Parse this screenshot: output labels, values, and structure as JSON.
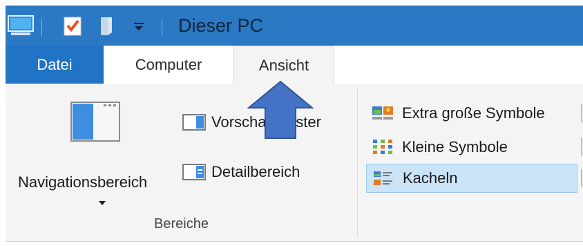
{
  "window": {
    "title": "Dieser PC"
  },
  "quick_access": {
    "icons": [
      "computer-icon",
      "properties-checkmark-icon",
      "new-folder-icon",
      "customize-dropdown-icon"
    ]
  },
  "tabs": [
    {
      "label": "Datei",
      "style": "file-tab",
      "color": "#2073c5"
    },
    {
      "label": "Computer"
    },
    {
      "label": "Ansicht",
      "active": true
    }
  ],
  "ribbon": {
    "panes_group": {
      "label": "Bereiche",
      "navigation_pane": {
        "label": "Navigationsbereich",
        "icon": "navigation-pane-icon"
      },
      "preview_pane": {
        "label": "Vorschaufenster",
        "icon": "preview-pane-icon"
      },
      "details_pane": {
        "label": "Detailbereich",
        "icon": "details-pane-icon"
      }
    },
    "layout_group": {
      "items": [
        {
          "label": "Extra große Symbole",
          "icon": "extra-large-icons-icon"
        },
        {
          "label": "Kleine Symbole",
          "icon": "small-icons-icon"
        },
        {
          "label": "Kacheln",
          "icon": "tiles-icon",
          "selected": true
        }
      ]
    }
  },
  "annotation": {
    "arrow_color": "#4472c4",
    "arrow_direction": "up"
  }
}
